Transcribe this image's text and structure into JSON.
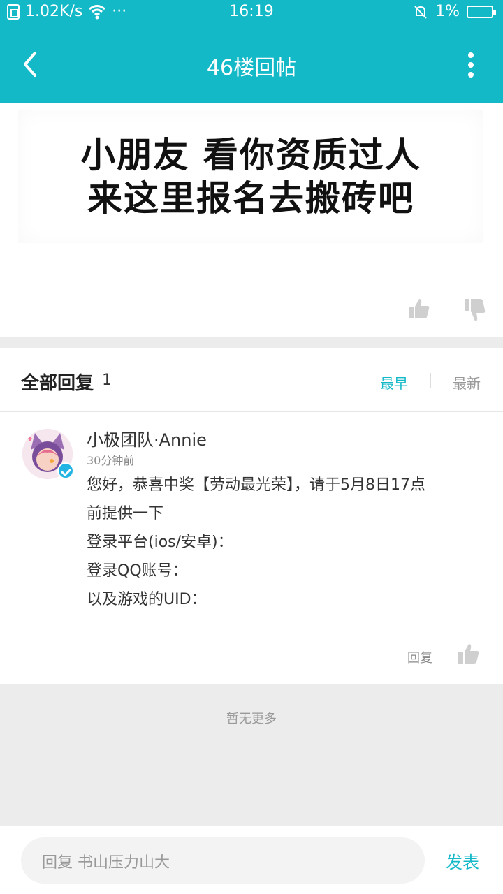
{
  "status_bar": {
    "speed": "1.02K/s",
    "dots": "···",
    "time": "16:19",
    "battery": "1%"
  },
  "header": {
    "title": "46楼回帖"
  },
  "post": {
    "image_text_line1": "小朋友  看你资质过人",
    "image_text_line2": "来这里报名去搬砖吧"
  },
  "replies": {
    "title": "全部回复",
    "count": "1",
    "sort_earliest": "最早",
    "sort_newest": "最新",
    "items": [
      {
        "author": "小极团队·Annie",
        "time": "30分钟前",
        "body_lines": [
          "您好，恭喜中奖【劳动最光荣】，请于5月8日17点",
          "前提供一下",
          "登录平台(ios/安卓)：",
          "登录QQ账号：",
          "以及游戏的UID："
        ],
        "reply_label": "回复"
      }
    ]
  },
  "footer": {
    "no_more": "暂无更多"
  },
  "input": {
    "placeholder": "回复 书山压力山大",
    "send_label": "发表"
  },
  "colors": {
    "accent": "#14b9c8",
    "text": "#333333",
    "muted": "#999999"
  }
}
